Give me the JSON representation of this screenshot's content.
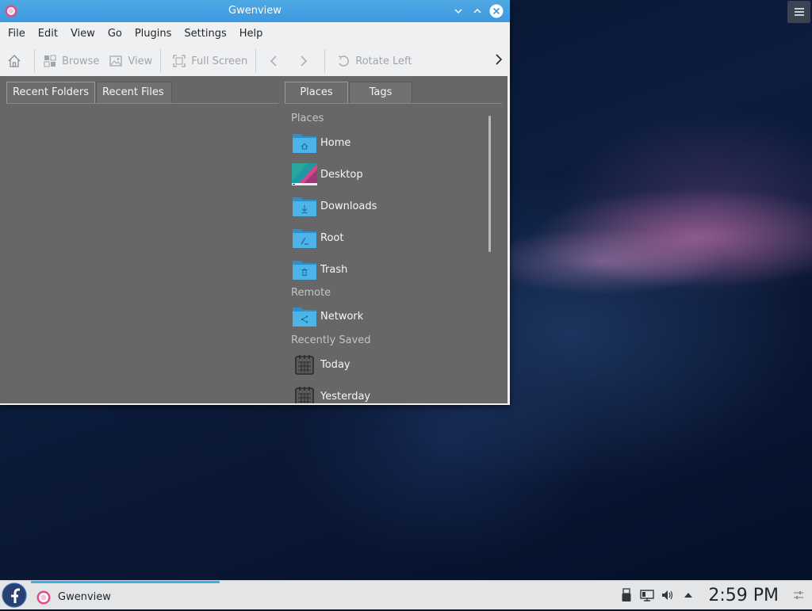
{
  "window": {
    "title": "Gwenview",
    "menus": [
      "File",
      "Edit",
      "View",
      "Go",
      "Plugins",
      "Settings",
      "Help"
    ],
    "toolbar": {
      "browse": "Browse",
      "view": "View",
      "fullscreen": "Full Screen",
      "rotate_left": "Rotate Left"
    },
    "left_tabs": [
      "Recent Folders",
      "Recent Files"
    ],
    "right_tabs": [
      "Places",
      "Tags"
    ],
    "sections": {
      "places": "Places",
      "remote": "Remote",
      "recently_saved": "Recently Saved"
    },
    "places": [
      {
        "label": "Home",
        "icon": "folder-home-icon"
      },
      {
        "label": "Desktop",
        "icon": "desktop-icon"
      },
      {
        "label": "Downloads",
        "icon": "folder-downloads-icon"
      },
      {
        "label": "Root",
        "icon": "folder-root-icon"
      },
      {
        "label": "Trash",
        "icon": "trash-icon"
      }
    ],
    "remote": [
      {
        "label": "Network",
        "icon": "folder-network-icon"
      }
    ],
    "recently_saved": [
      {
        "label": "Today",
        "icon": "calendar-icon"
      },
      {
        "label": "Yesterday",
        "icon": "calendar-icon"
      }
    ]
  },
  "taskbar": {
    "task_label": "Gwenview",
    "clock": "2:59 PM"
  },
  "colors": {
    "titlebar": "#3d9ae0",
    "accent": "#3daee9",
    "content_bg": "#676767",
    "folder": "#4cb4e8"
  }
}
